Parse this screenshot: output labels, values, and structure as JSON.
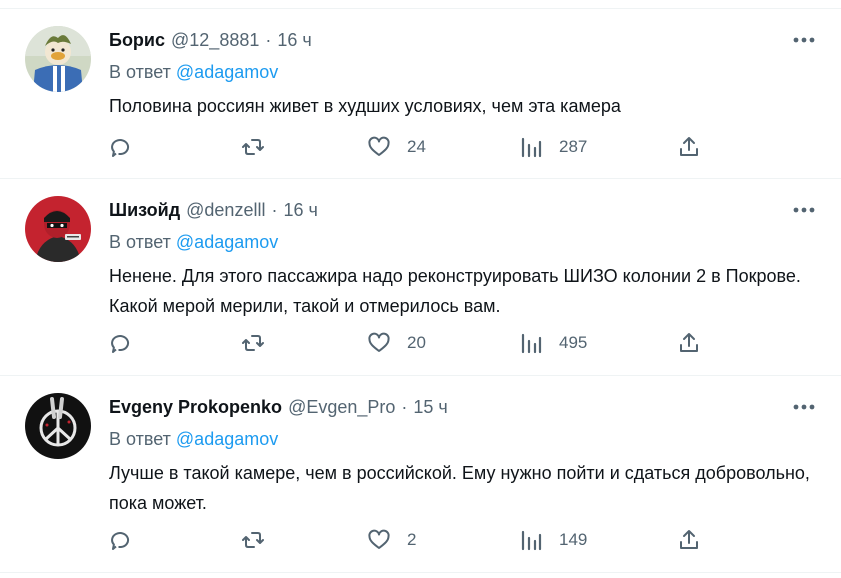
{
  "tweets": [
    {
      "name": "Борис",
      "handle": "@12_8881",
      "dot": "·",
      "time": "16 ч",
      "reply_prefix": "В ответ",
      "reply_mention": "@adagamov",
      "text": "Половина россиян живет в худших условиях, чем эта камера",
      "likes": "24",
      "views": "287"
    },
    {
      "name": "Шизойд",
      "handle": "@denzelll",
      "dot": "·",
      "time": "16 ч",
      "reply_prefix": "В ответ",
      "reply_mention": "@adagamov",
      "text": "Ненене. Для этого пассажира надо реконструировать ШИЗО колонии 2 в Покрове. Какой мерой мерили, такой и отмерилось вам.",
      "likes": "20",
      "views": "495"
    },
    {
      "name": "Evgeny Prokopenko",
      "handle": "@Evgen_Pro",
      "dot": "·",
      "time": "15 ч",
      "reply_prefix": "В ответ",
      "reply_mention": "@adagamov",
      "text": "Лучше в такой камере, чем в российской. Ему нужно пойти и сдаться добровольно, пока может.",
      "likes": "2",
      "views": "149"
    }
  ],
  "icons": {
    "reply": "reply-icon",
    "retweet": "retweet-icon",
    "like": "heart-icon",
    "views": "views-icon",
    "share": "share-icon",
    "more": "more-icon"
  },
  "colors": {
    "text": "#0f1419",
    "muted": "#536471",
    "link": "#1d9bf0",
    "divider": "#eff3f4"
  }
}
